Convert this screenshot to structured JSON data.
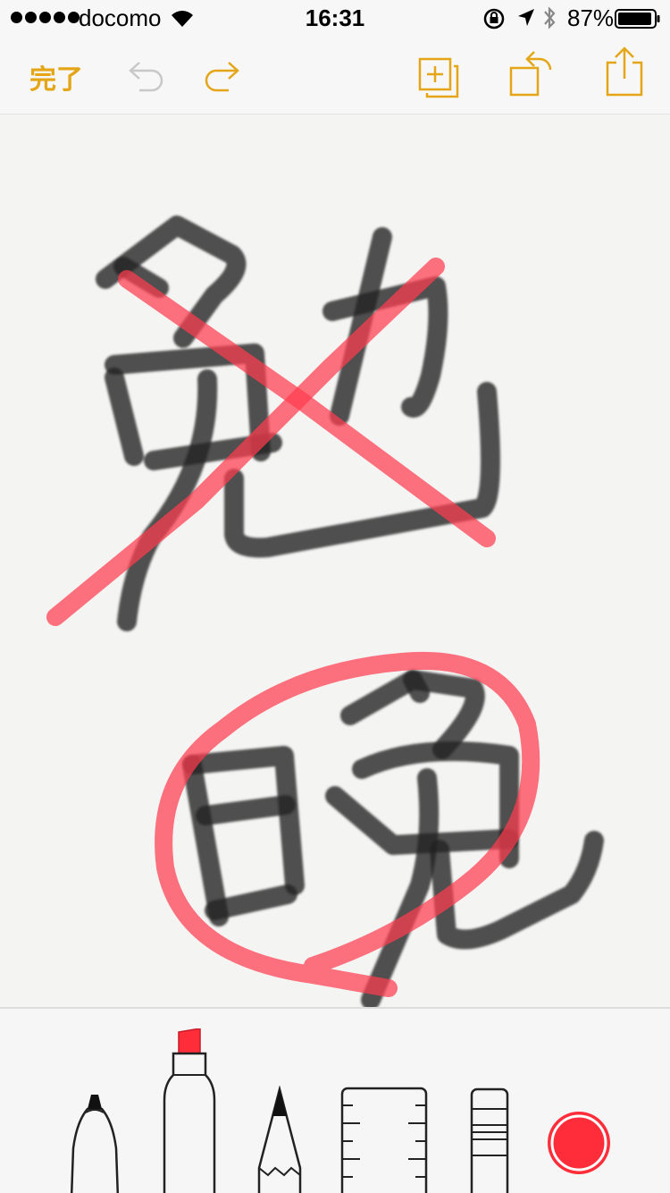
{
  "status_bar": {
    "carrier": "docomo",
    "time": "16:31",
    "battery_percent": "87%"
  },
  "toolbar": {
    "done_label": "完了",
    "accent_color": "#e4a617",
    "icons": [
      "undo-icon",
      "redo-icon",
      "add-page-icon",
      "rotate-page-icon",
      "share-icon"
    ]
  },
  "canvas": {
    "ink_color": "#222222",
    "highlight_color": "#ff3b4e",
    "strokes": [
      "black-marker",
      "red-highlighter"
    ]
  },
  "palette": {
    "tools": [
      "pen",
      "marker",
      "pencil",
      "ruler",
      "eraser",
      "color-picker"
    ],
    "selected_tool": "marker",
    "selected_color": "#ff2d3a"
  }
}
